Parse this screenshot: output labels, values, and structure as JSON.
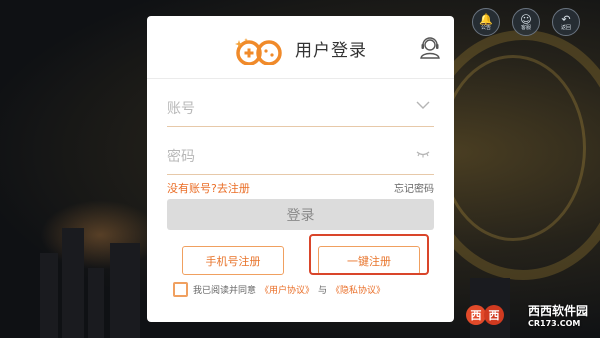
{
  "top_icons": [
    {
      "name": "notice",
      "label": "公告",
      "glyph": "🔔"
    },
    {
      "name": "support",
      "label": "客服",
      "glyph": "☺"
    },
    {
      "name": "back",
      "label": "返回",
      "glyph": "↶"
    }
  ],
  "login": {
    "title": "用户登录",
    "account_placeholder": "账号",
    "password_placeholder": "密码",
    "no_account_link": "没有账号?去注册",
    "forgot_password": "忘记密码",
    "login_button": "登录",
    "phone_register": "手机号注册",
    "one_click_register": "一键注册",
    "agree_prefix": "我已阅读并同意",
    "user_agreement": "《用户协议》",
    "and": "与",
    "privacy_agreement": "《隐私协议》"
  },
  "watermark": {
    "name": "西西软件园",
    "url": "CR173.COM",
    "logo": "西西"
  },
  "colors": {
    "accent": "#ea6e27",
    "highlight": "#d9452a"
  }
}
